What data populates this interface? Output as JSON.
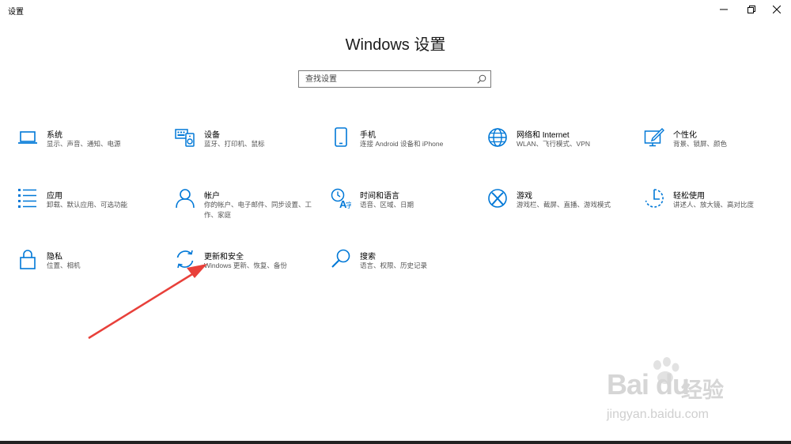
{
  "window": {
    "app_title": "设置",
    "controls": [
      "minimize",
      "restore",
      "close"
    ]
  },
  "page": {
    "title": "Windows 设置"
  },
  "search": {
    "placeholder": "查找设置",
    "value": ""
  },
  "tiles": [
    {
      "name": "系统",
      "desc": "显示、声音、通知、电源",
      "icon": "laptop-icon"
    },
    {
      "name": "设备",
      "desc": "蓝牙、打印机、鼠标",
      "icon": "devices-icon"
    },
    {
      "name": "手机",
      "desc": "连接 Android 设备和 iPhone",
      "icon": "phone-icon"
    },
    {
      "name": "网络和 Internet",
      "desc": "WLAN、飞行模式、VPN",
      "icon": "globe-icon"
    },
    {
      "name": "个性化",
      "desc": "背景、锁屏、颜色",
      "icon": "personalization-icon"
    },
    {
      "name": "应用",
      "desc": "卸载、默认应用、可选功能",
      "icon": "apps-list-icon"
    },
    {
      "name": "帐户",
      "desc": "你的帐户、电子邮件、同步设置、工作、家庭",
      "icon": "account-icon"
    },
    {
      "name": "时间和语言",
      "desc": "语音、区域、日期",
      "icon": "time-language-icon"
    },
    {
      "name": "游戏",
      "desc": "游戏栏、截屏、直播、游戏模式",
      "icon": "xbox-icon"
    },
    {
      "name": "轻松使用",
      "desc": "讲述人、放大镜、高对比度",
      "icon": "ease-of-access-icon"
    },
    {
      "name": "隐私",
      "desc": "位置、相机",
      "icon": "lock-icon"
    },
    {
      "name": "更新和安全",
      "desc": "Windows 更新、恢复、备份",
      "icon": "sync-icon"
    },
    {
      "name": "搜索",
      "desc": "语言、权限、历史记录",
      "icon": "search-magnifier-icon"
    }
  ],
  "watermark": {
    "logo_text": "Bai du",
    "cn_text": "经验",
    "url": "jingyan.baidu.com"
  },
  "colors": {
    "accent": "#0078d7",
    "annotation_arrow": "#e8403a",
    "background": "#ffffff"
  }
}
